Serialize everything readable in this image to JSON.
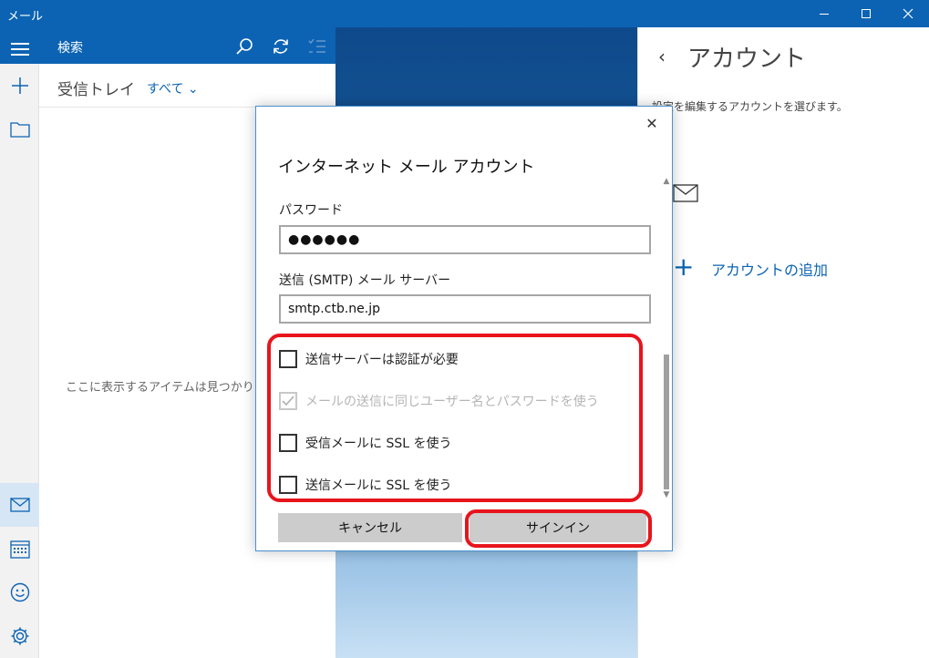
{
  "window": {
    "title": "メール"
  },
  "sidebar": {
    "items": [
      {
        "icon": "hamburger-menu-icon"
      },
      {
        "icon": "plus-icon"
      },
      {
        "icon": "folder-icon"
      },
      {
        "icon": "mail-icon"
      },
      {
        "icon": "calendar-icon"
      },
      {
        "icon": "smiley-icon"
      },
      {
        "icon": "gear-icon"
      }
    ]
  },
  "list": {
    "search_label": "検索",
    "folder_name": "受信トレイ",
    "filter_label": "すべて ⌄",
    "empty_message": "ここに表示するアイテムは見つかりませ"
  },
  "account_panel": {
    "back_glyph": "‹",
    "title": "アカウント",
    "description": "設定を編集するアカウントを選びます。",
    "add_plus": "+",
    "add_account_label": "アカウントの追加"
  },
  "dialog": {
    "close_glyph": "✕",
    "title": "インターネット メール アカウント",
    "password_label": "パスワード",
    "password_value": "●●●●●●",
    "smtp_label": "送信 (SMTP) メール サーバー",
    "smtp_value": "smtp.ctb.ne.jp",
    "checkboxes": [
      {
        "label": "送信サーバーは認証が必要",
        "checked": false,
        "disabled": false
      },
      {
        "label": "メールの送信に同じユーザー名とパスワードを使う",
        "checked": true,
        "disabled": true
      },
      {
        "label": "受信メールに SSL を使う",
        "checked": false,
        "disabled": false
      },
      {
        "label": "送信メールに SSL を使う",
        "checked": false,
        "disabled": false
      }
    ],
    "cancel_label": "キャンセル",
    "signin_label": "サインイン"
  },
  "colors": {
    "accent": "#0c63b3",
    "highlight": "#e8141c"
  }
}
